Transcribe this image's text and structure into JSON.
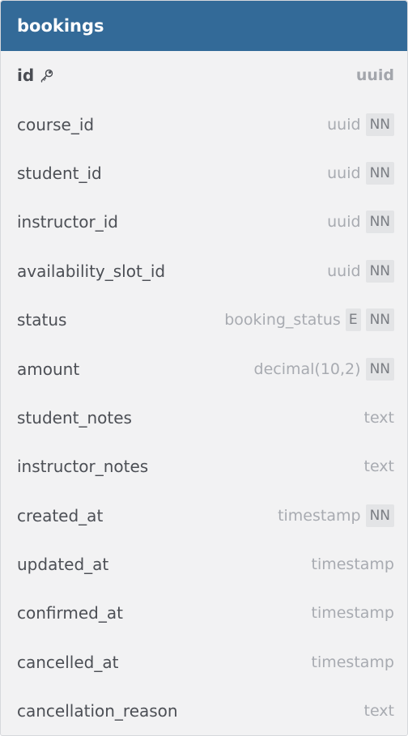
{
  "table": {
    "name": "bookings",
    "columns": [
      {
        "name": "id",
        "type": "uuid",
        "pk": true,
        "enum": false,
        "not_null": false
      },
      {
        "name": "course_id",
        "type": "uuid",
        "pk": false,
        "enum": false,
        "not_null": true
      },
      {
        "name": "student_id",
        "type": "uuid",
        "pk": false,
        "enum": false,
        "not_null": true
      },
      {
        "name": "instructor_id",
        "type": "uuid",
        "pk": false,
        "enum": false,
        "not_null": true
      },
      {
        "name": "availability_slot_id",
        "type": "uuid",
        "pk": false,
        "enum": false,
        "not_null": true
      },
      {
        "name": "status",
        "type": "booking_status",
        "pk": false,
        "enum": true,
        "not_null": true
      },
      {
        "name": "amount",
        "type": "decimal(10,2)",
        "pk": false,
        "enum": false,
        "not_null": true
      },
      {
        "name": "student_notes",
        "type": "text",
        "pk": false,
        "enum": false,
        "not_null": false
      },
      {
        "name": "instructor_notes",
        "type": "text",
        "pk": false,
        "enum": false,
        "not_null": false
      },
      {
        "name": "created_at",
        "type": "timestamp",
        "pk": false,
        "enum": false,
        "not_null": true
      },
      {
        "name": "updated_at",
        "type": "timestamp",
        "pk": false,
        "enum": false,
        "not_null": false
      },
      {
        "name": "confirmed_at",
        "type": "timestamp",
        "pk": false,
        "enum": false,
        "not_null": false
      },
      {
        "name": "cancelled_at",
        "type": "timestamp",
        "pk": false,
        "enum": false,
        "not_null": false
      },
      {
        "name": "cancellation_reason",
        "type": "text",
        "pk": false,
        "enum": false,
        "not_null": false
      }
    ]
  },
  "labels": {
    "not_null_badge": "NN",
    "enum_badge": "E"
  },
  "icons": {
    "primary_key": "key-icon"
  },
  "colors": {
    "header_bg": "#336a98",
    "header_text": "#ffffff",
    "card_bg": "#f2f2f3",
    "name_text": "#4c4f55",
    "type_text": "#a8abb1",
    "badge_bg": "#e3e4e6"
  }
}
